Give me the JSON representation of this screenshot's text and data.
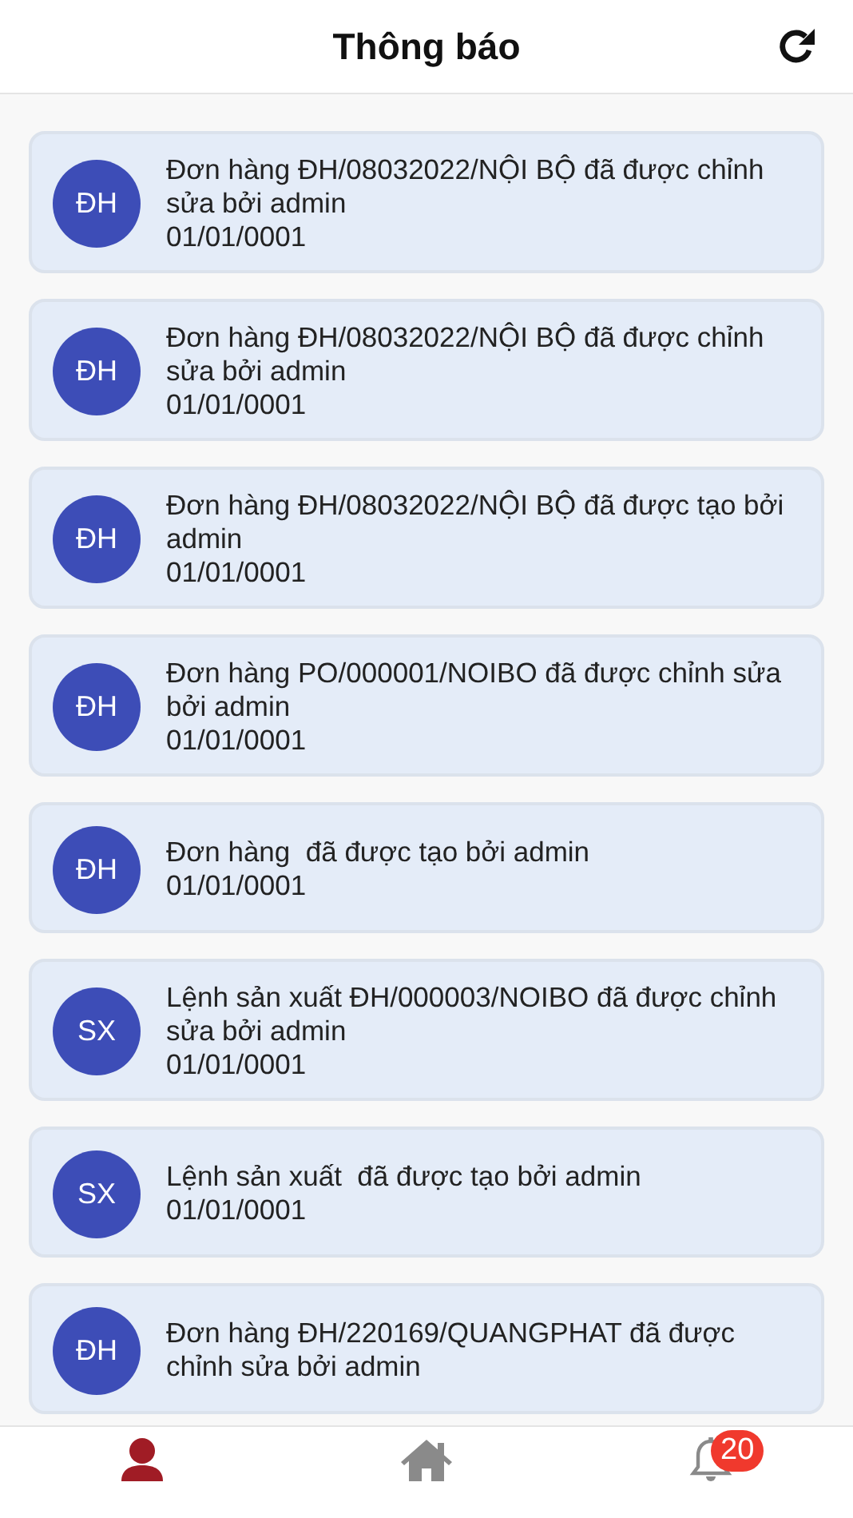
{
  "header": {
    "title": "Thông báo"
  },
  "notifications": [
    {
      "avatar": "ĐH",
      "message": "Đơn hàng ĐH/08032022/NỘI BỘ đã được chỉnh sửa bởi admin",
      "date": "01/01/0001"
    },
    {
      "avatar": "ĐH",
      "message": "Đơn hàng ĐH/08032022/NỘI BỘ đã được chỉnh sửa bởi admin",
      "date": "01/01/0001"
    },
    {
      "avatar": "ĐH",
      "message": "Đơn hàng ĐH/08032022/NỘI BỘ đã được tạo bởi admin",
      "date": "01/01/0001"
    },
    {
      "avatar": "ĐH",
      "message": "Đơn hàng PO/000001/NOIBO đã được chỉnh sửa bởi admin",
      "date": "01/01/0001"
    },
    {
      "avatar": "ĐH",
      "message": "Đơn hàng  đã được tạo bởi admin",
      "date": "01/01/0001"
    },
    {
      "avatar": "SX",
      "message": "Lệnh sản xuất ĐH/000003/NOIBO đã được chỉnh sửa bởi admin",
      "date": "01/01/0001"
    },
    {
      "avatar": "SX",
      "message": "Lệnh sản xuất  đã được tạo bởi admin",
      "date": "01/01/0001"
    },
    {
      "avatar": "ĐH",
      "message": "Đơn hàng ĐH/220169/QUANGPHAT đã được chỉnh sửa bởi admin"
    }
  ],
  "tab_bar": [
    {
      "kind": "profile",
      "selected": true
    },
    {
      "kind": "home",
      "selected": false
    },
    {
      "kind": "notifications",
      "selected": false,
      "badge": "20"
    }
  ]
}
